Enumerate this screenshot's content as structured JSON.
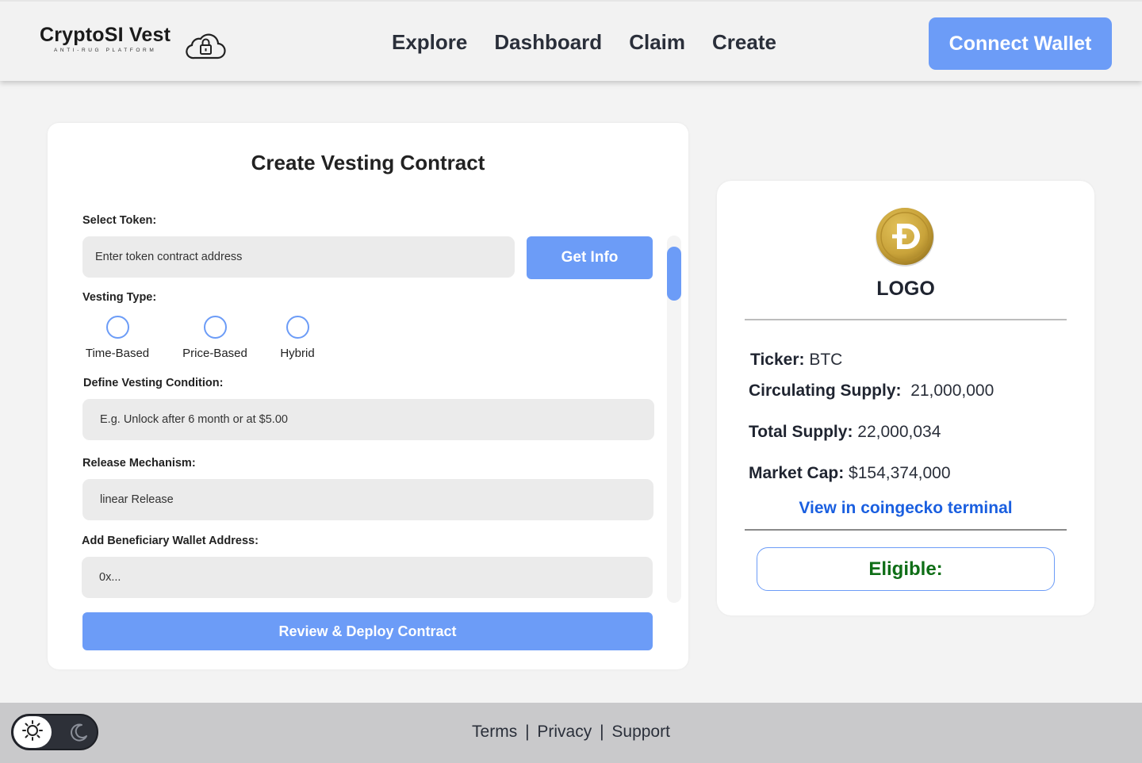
{
  "header": {
    "brand_title": "CryptoSI Vest",
    "brand_tagline": "ANTI-RUG PLATFORM",
    "nav": [
      {
        "label": "Explore"
      },
      {
        "label": "Dashboard"
      },
      {
        "label": "Claim"
      },
      {
        "label": "Create"
      }
    ],
    "connect_label": "Connect Wallet",
    "accent_color": "#6c9cf7"
  },
  "form": {
    "title": "Create Vesting Contract",
    "select_token_label": "Select Token:",
    "token_placeholder": "Enter token contract address",
    "get_info_label": "Get Info",
    "vesting_type_label": "Vesting Type:",
    "vesting_types": [
      {
        "label": "Time-Based",
        "selected": false
      },
      {
        "label": "Price-Based",
        "selected": false
      },
      {
        "label": "Hybrid",
        "selected": false
      }
    ],
    "condition_label": "Define Vesting Condition:",
    "condition_placeholder": "E.g. Unlock after 6 month or at $5.00",
    "release_label": "Release Mechanism:",
    "release_value": "linear Release",
    "beneficiary_label": "Add Beneficiary Wallet Address:",
    "beneficiary_placeholder": "0x...",
    "deploy_label": "Review & Deploy Contract"
  },
  "token_info": {
    "coin_icon": "dogecoin-icon",
    "logo_label": "LOGO",
    "ticker_label": "Ticker:",
    "ticker_value": "BTC",
    "circ_label": "Circulating Supply:",
    "circ_value": "21,000,000",
    "total_label": "Total Supply:",
    "total_value": "22,000,034",
    "mcap_label": "Market Cap:",
    "mcap_value": "$154,374,000",
    "coingecko_link": "View in coingecko terminal",
    "eligible_label": "Eligible:",
    "eligible_color": "#0f6e17",
    "link_color": "#1a5fe0"
  },
  "footer": {
    "links": [
      {
        "label": "Terms"
      },
      {
        "label": "Privacy"
      },
      {
        "label": "Support"
      }
    ],
    "separator": "|",
    "theme_mode": "light"
  }
}
